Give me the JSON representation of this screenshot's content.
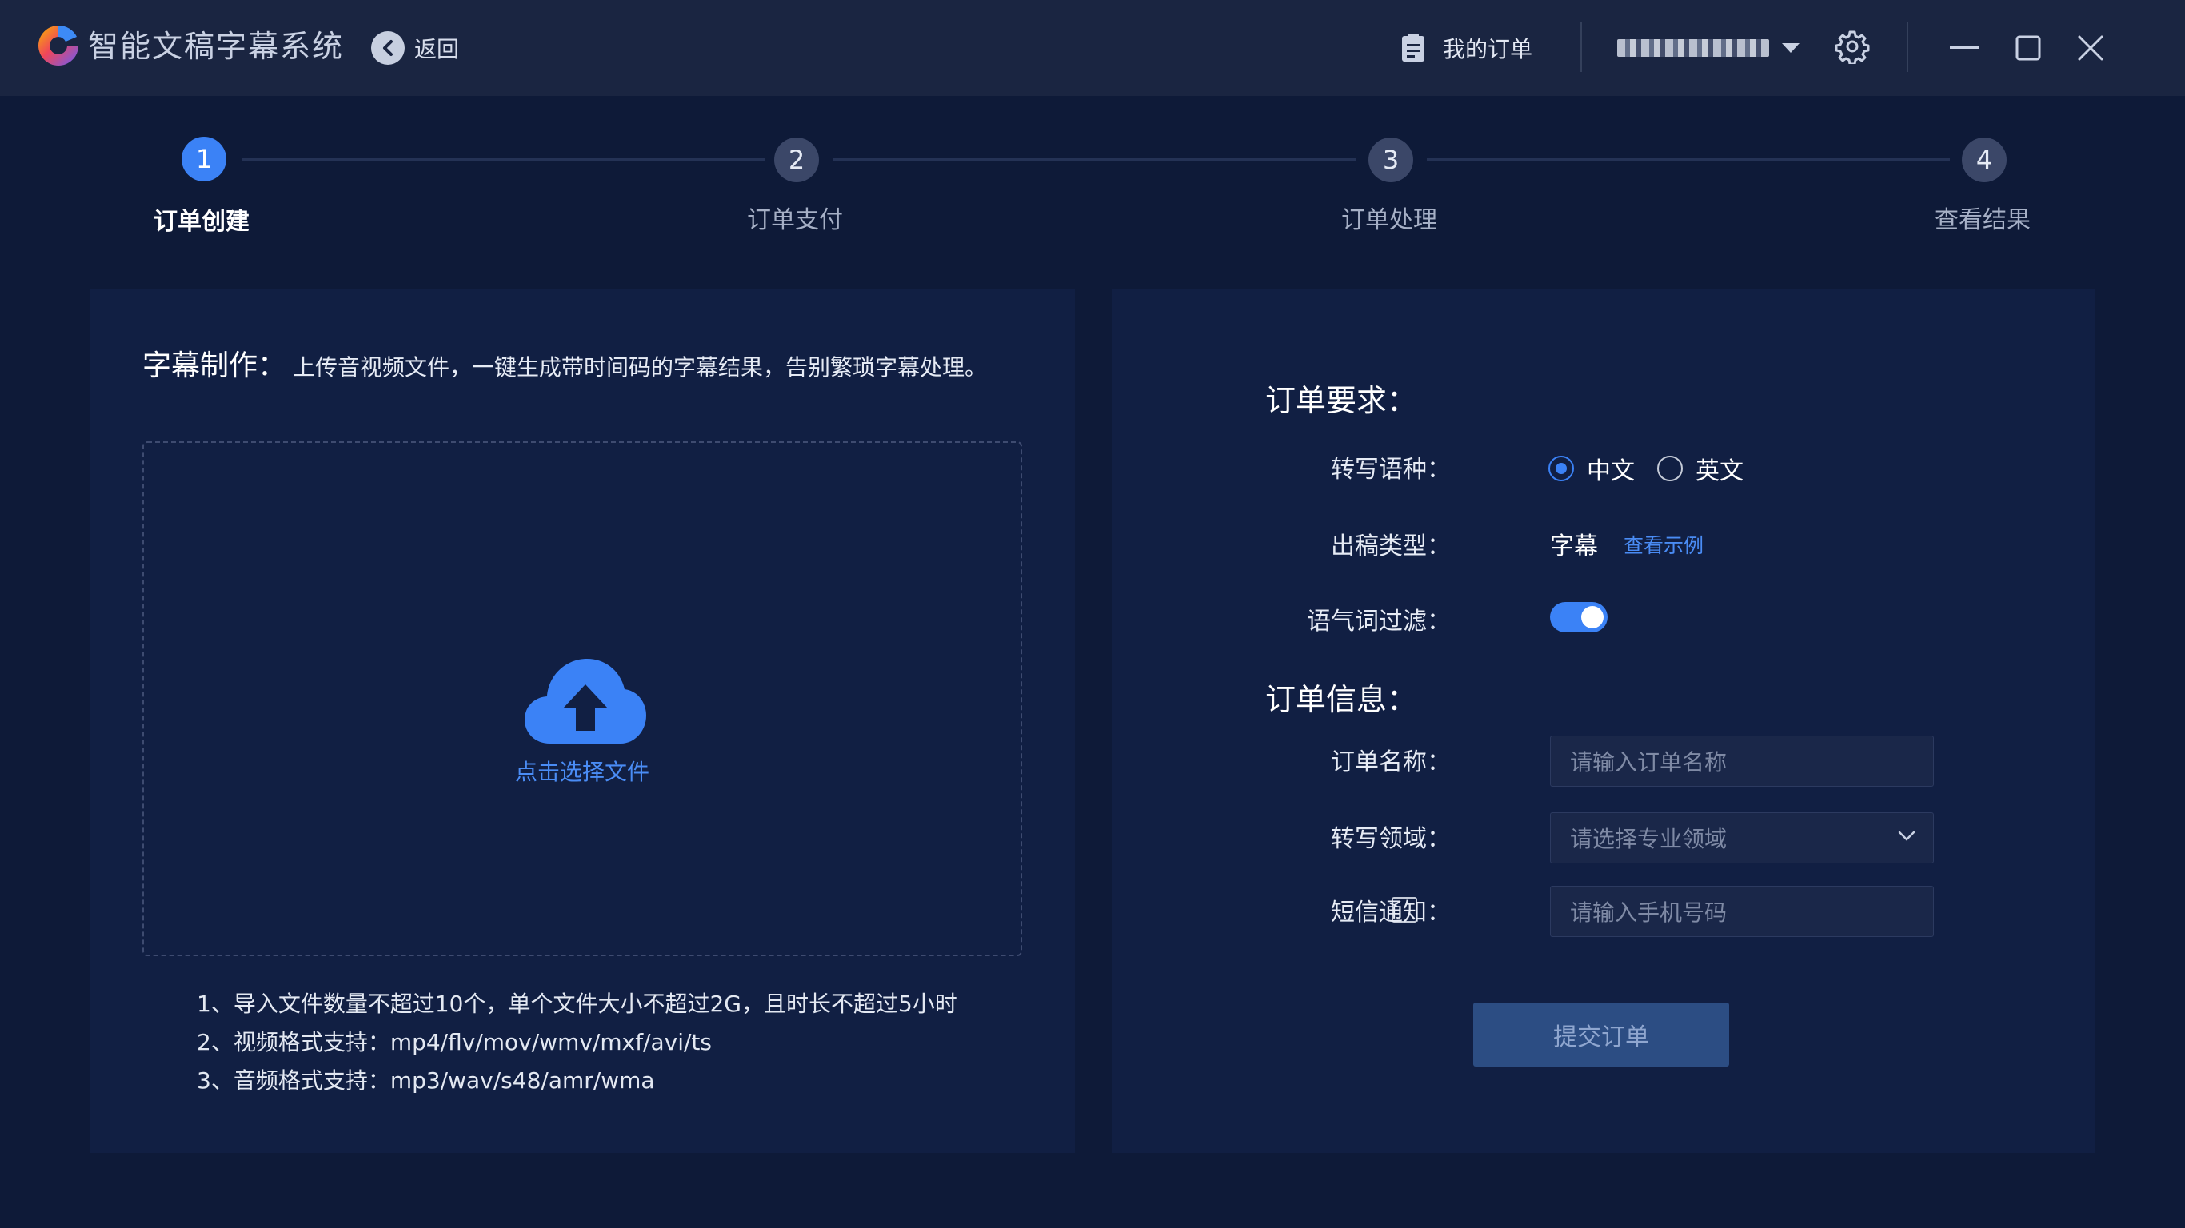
{
  "app": {
    "title": "智能文稿字幕系统",
    "back_label": "返回",
    "my_orders_label": "我的订单",
    "window_controls": [
      "minimize-icon",
      "maximize-icon",
      "close-icon"
    ]
  },
  "colors": {
    "background": "#0e1a38",
    "titlebar": "#1a2541",
    "panel": "#111f43",
    "accent": "#3b82f6",
    "link": "#4a8cf5",
    "submit_bg": "#2c4d83"
  },
  "steps": [
    {
      "number": "1",
      "label": "订单创建",
      "active": true
    },
    {
      "number": "2",
      "label": "订单支付",
      "active": false
    },
    {
      "number": "3",
      "label": "订单处理",
      "active": false
    },
    {
      "number": "4",
      "label": "查看结果",
      "active": false
    }
  ],
  "upload": {
    "title": "字幕制作",
    "colon": "：",
    "description": "上传音视频文件，一键生成带时间码的字幕结果，告别繁琐字幕处理。",
    "icon": "cloud-upload-icon",
    "pick_label": "点击选择文件",
    "notes": [
      "1、导入文件数量不超过10个，单个文件大小不超过2G，且时长不超过5小时",
      "2、视频格式支持：mp4/flv/mov/wmv/mxf/avi/ts",
      "3、音频格式支持：mp3/wav/s48/amr/wma"
    ]
  },
  "requirements": {
    "title": "订单要求：",
    "language_label": "转写语种：",
    "languages": [
      {
        "label": "中文",
        "selected": true
      },
      {
        "label": "英文",
        "selected": false
      }
    ],
    "output_label": "出稿类型：",
    "output_value": "字幕",
    "example_link": "查看示例",
    "filter_label": "语气词过滤：",
    "filter_on": true
  },
  "info": {
    "title": "订单信息：",
    "name_label": "订单名称：",
    "name_placeholder": "请输入订单名称",
    "domain_label": "转写领域：",
    "domain_placeholder": "请选择专业领域",
    "sms_label": "短信通知：",
    "sms_checked": false,
    "phone_placeholder": "请输入手机号码"
  },
  "submit_label": "提交订单"
}
